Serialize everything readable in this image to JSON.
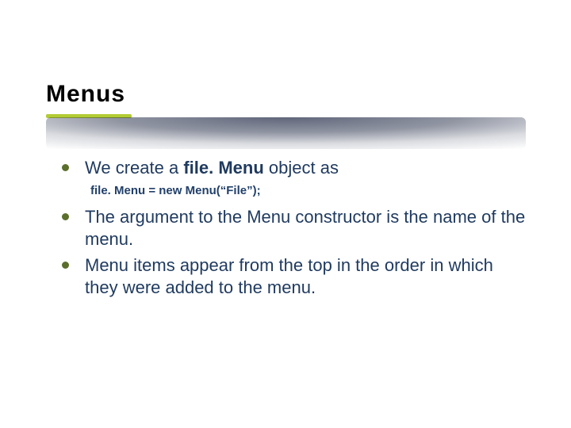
{
  "title": "Menus",
  "items": [
    {
      "pre": "We create a ",
      "bold": "file. Menu",
      "post": " object as",
      "code": "file. Menu = new Menu(“File”);"
    },
    {
      "text": "The argument to the Menu constructor is the name of the menu."
    },
    {
      "text": "Menu items appear from the top in the order in which they were added to the menu."
    }
  ]
}
